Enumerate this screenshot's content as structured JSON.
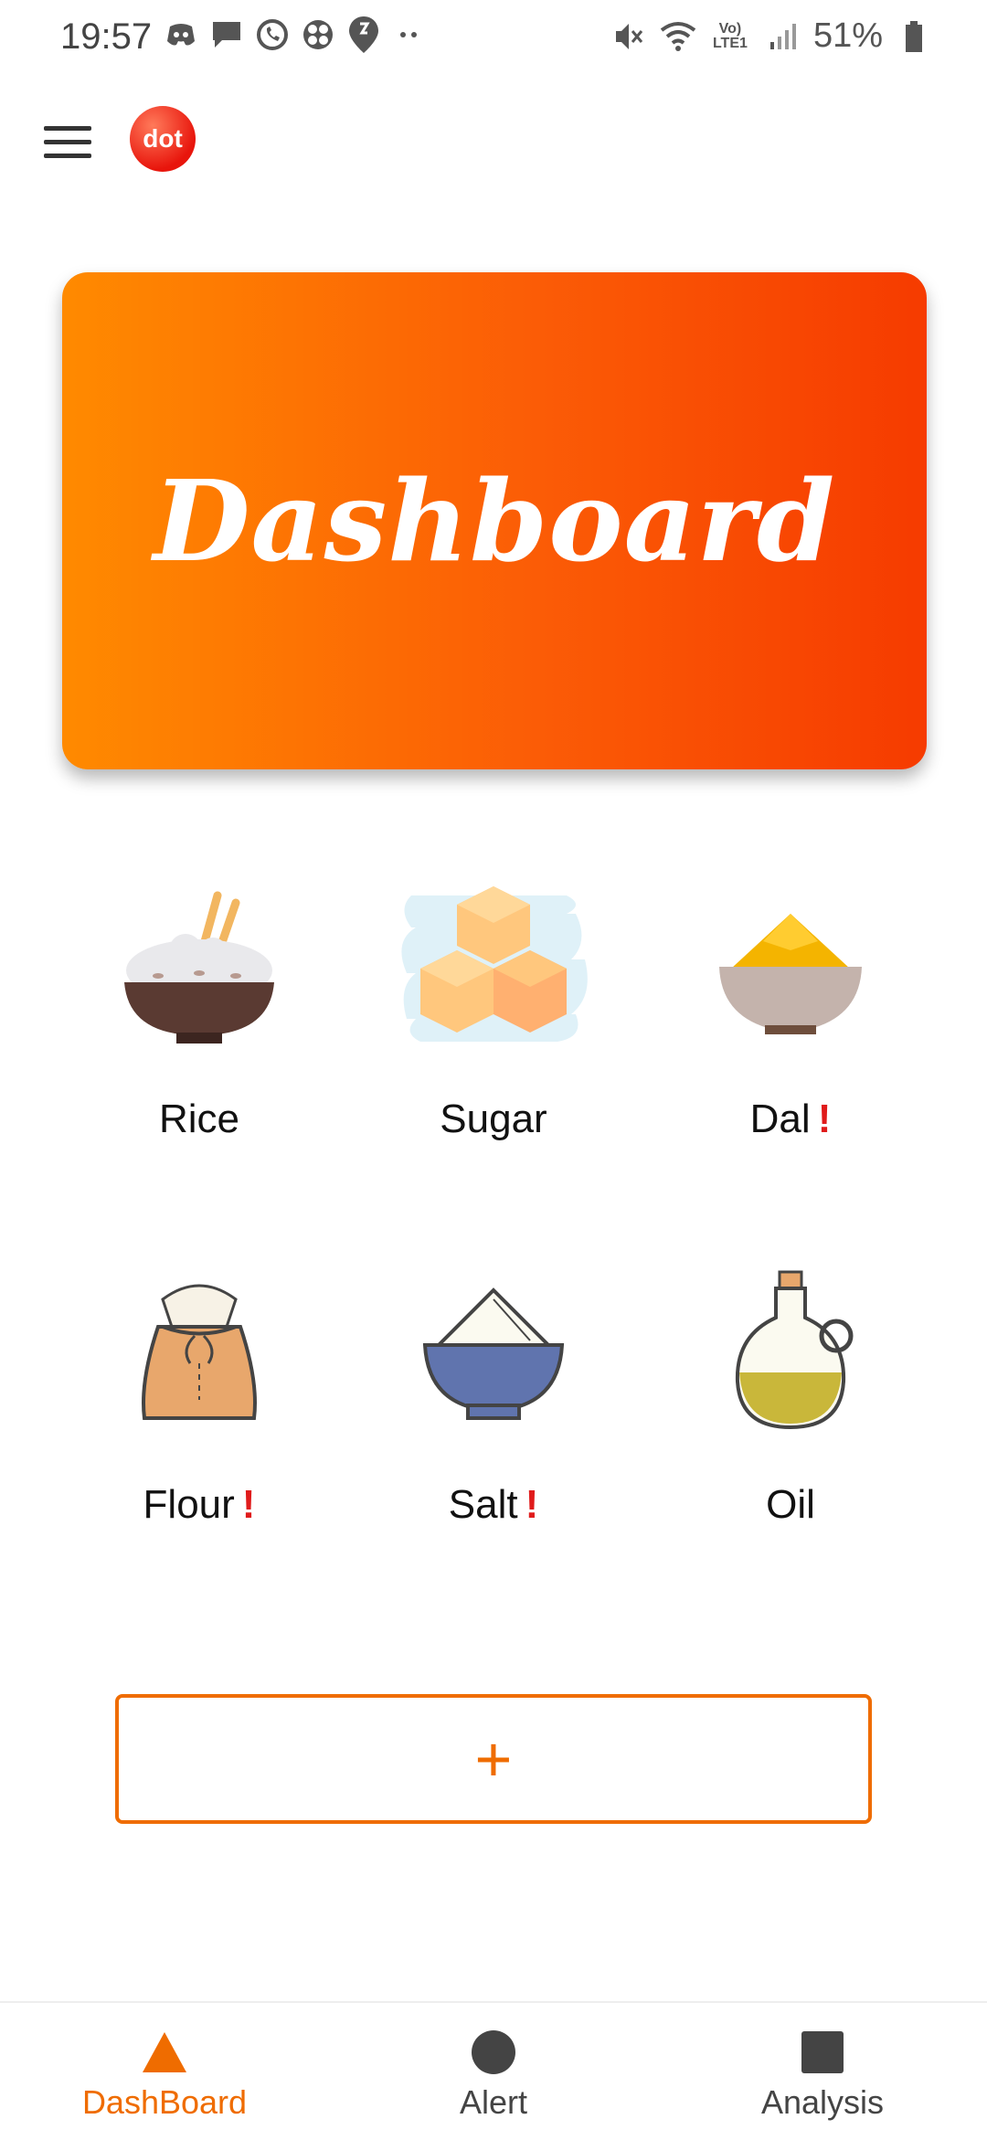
{
  "status_bar": {
    "time": "19:57",
    "left_icons": [
      "discord-icon",
      "message-icon",
      "whatsapp-icon",
      "app-icon",
      "location-icon",
      "more-dots-icon"
    ],
    "right_icons": [
      "mute-icon",
      "wifi-icon",
      "volte-icon",
      "signal-icon",
      "battery-icon"
    ],
    "volte_text": "Vo) LTE1",
    "battery": "51%"
  },
  "app_bar": {
    "logo_text": "dot"
  },
  "banner": {
    "title": "Dashboard"
  },
  "items": [
    {
      "label": "Rice",
      "alert": false,
      "icon": "rice-bowl-icon"
    },
    {
      "label": "Sugar",
      "alert": false,
      "icon": "sugar-cubes-icon"
    },
    {
      "label": "Dal",
      "alert": true,
      "icon": "dal-bowl-icon"
    },
    {
      "label": "Flour",
      "alert": true,
      "icon": "flour-sack-icon"
    },
    {
      "label": "Salt",
      "alert": true,
      "icon": "salt-bowl-icon"
    },
    {
      "label": "Oil",
      "alert": false,
      "icon": "oil-bottle-icon"
    }
  ],
  "alert_symbol": "!",
  "add_button": {
    "symbol": "+"
  },
  "bottom_nav": {
    "items": [
      {
        "label": "DashBoard",
        "active": true,
        "icon": "triangle-icon"
      },
      {
        "label": "Alert",
        "active": false,
        "icon": "circle-icon"
      },
      {
        "label": "Analysis",
        "active": false,
        "icon": "square-icon"
      }
    ]
  },
  "colors": {
    "accent": "#ef6c00",
    "alert": "#e01b1b",
    "banner_start": "#ff8a00",
    "banner_end": "#f63b00"
  }
}
